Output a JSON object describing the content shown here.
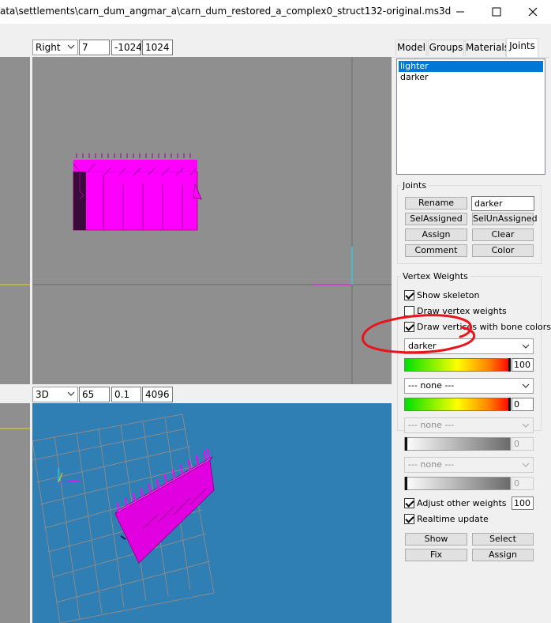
{
  "window": {
    "title": "ata\\settlements\\carn_dum_angmar_a\\carn_dum_restored_a_complex0_struct132-original.ms3d",
    "icons": [
      "minimize-icon",
      "maximize-icon",
      "close-icon"
    ]
  },
  "viewport_top": {
    "view_select": "Right",
    "field1": "7",
    "field2": "-1024",
    "field3": "1024"
  },
  "viewport_bottom": {
    "view_select": "3D",
    "field1": "65",
    "field2": "0.1",
    "field3": "4096"
  },
  "tabs": [
    {
      "label": "Model"
    },
    {
      "label": "Groups"
    },
    {
      "label": "Materials"
    },
    {
      "label": "Joints"
    }
  ],
  "joints_list": [
    {
      "label": "lighter",
      "selected": true
    },
    {
      "label": "darker",
      "selected": false
    }
  ],
  "joints_group": {
    "title": "Joints",
    "rename_label": "Rename",
    "name_value": "darker",
    "selassigned_label": "SelAssigned",
    "selunassigned_label": "SelUnAssigned",
    "assign_label": "Assign",
    "clear_label": "Clear",
    "comment_label": "Comment",
    "color_label": "Color"
  },
  "vertex_weights": {
    "title": "Vertex Weights",
    "show_skeleton": {
      "label": "Show skeleton",
      "checked": true
    },
    "draw_vertex_weights": {
      "label": "Draw vertex weights",
      "checked": false
    },
    "draw_vertices_bone_colors": {
      "label": "Draw vertices with bone colors",
      "checked": true
    },
    "bone1": {
      "value": "darker",
      "weight": "100",
      "fill": 1.0
    },
    "bone2": {
      "value": "--- none ---",
      "weight": "0",
      "fill": 1.0
    },
    "bone3": {
      "value": "--- none ---",
      "weight": "0",
      "disabled": true
    },
    "bone4": {
      "value": "--- none ---",
      "weight": "0",
      "disabled": true
    },
    "adjust_other": {
      "label": "Adjust other weights",
      "checked": true,
      "value": "100"
    },
    "realtime": {
      "label": "Realtime update",
      "checked": true
    },
    "show_label": "Show",
    "select_label": "Select",
    "fix_label": "Fix",
    "assign_label": "Assign"
  },
  "colors": {
    "viewport_gray": "#8f8f8f",
    "viewport_3d": "#2f7eb4",
    "model_magenta": "#ff00ff",
    "selection_blue": "#0078d7",
    "annotation_red": "#e8141c"
  }
}
